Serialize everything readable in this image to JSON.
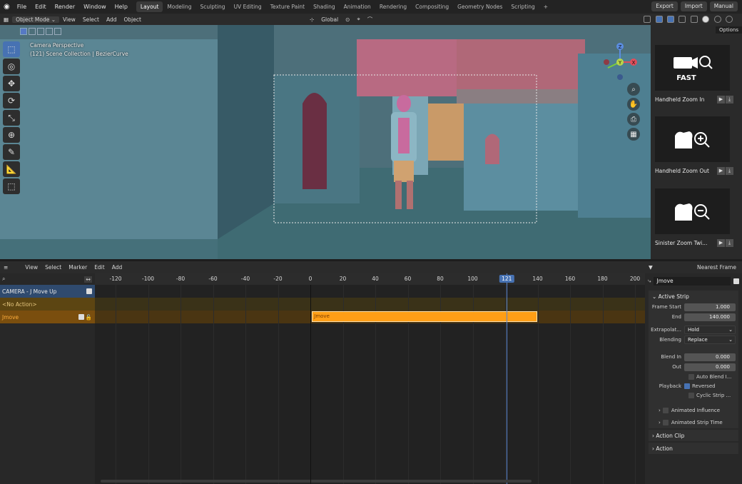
{
  "topbar": {
    "menus": [
      "File",
      "Edit",
      "Render",
      "Window",
      "Help"
    ],
    "workspaces": [
      "Layout",
      "Modeling",
      "Sculpting",
      "UV Editing",
      "Texture Paint",
      "Shading",
      "Animation",
      "Rendering",
      "Compositing",
      "Geometry Nodes",
      "Scripting"
    ],
    "active_workspace": "Layout",
    "add_tab": "+",
    "export_label": "Export",
    "import_label": "Import",
    "manual_label": "Manual"
  },
  "viewport_header": {
    "mode": "Object Mode",
    "menus": [
      "View",
      "Select",
      "Add",
      "Object"
    ],
    "transform_orientation": "Global"
  },
  "viewport": {
    "camera_label": "Camera Perspective",
    "collection_label": "(121) Scene Collection | BezierCurve",
    "gizmo_axes": {
      "x": "X",
      "y": "Y",
      "z": "Z"
    }
  },
  "asset_panel": {
    "options_label": "Options",
    "assets": [
      {
        "name": "Handheld Zoom In",
        "thumb_text": "FAST"
      },
      {
        "name": "Handheld Zoom Out",
        "thumb_text": ""
      },
      {
        "name": "Sinister Zoom Twi...",
        "thumb_text": ""
      }
    ]
  },
  "nla_header": {
    "menus": [
      "View",
      "Select",
      "Marker",
      "Edit",
      "Add"
    ],
    "snap_label": "Nearest Frame"
  },
  "channels": {
    "camera": "CAMERA - J Move Up",
    "no_action": "<No Action>",
    "track": "Jmove"
  },
  "timeline": {
    "ticks": [
      -120,
      -100,
      -80,
      -60,
      -40,
      -20,
      0,
      20,
      40,
      60,
      80,
      100,
      120,
      140,
      160,
      180,
      200
    ],
    "current_frame": 121,
    "strip": {
      "name": "Jmove",
      "start": 1,
      "end": 140
    }
  },
  "properties": {
    "strip_name": "Jmove",
    "active_strip_title": "Active Strip",
    "frame_start_label": "Frame Start",
    "frame_start": "1.000",
    "end_label": "End",
    "end": "140.000",
    "extrapolation_label": "Extrapolat...",
    "extrapolation": "Hold",
    "blending_label": "Blending",
    "blending": "Replace",
    "blend_in_label": "Blend In",
    "blend_in": "0.000",
    "out_label": "Out",
    "blend_out": "0.000",
    "auto_blend": "Auto Blend I...",
    "playback_label": "Playback",
    "reversed": "Reversed",
    "cyclic": "Cyclic Strip ...",
    "animated_influence": "Animated Influence",
    "animated_strip_time": "Animated Strip Time",
    "action_clip": "Action Clip",
    "action": "Action"
  },
  "colors": {
    "accent": "#4772b3",
    "strip": "#ff9e16",
    "viewport_bg": "#5d8896"
  }
}
